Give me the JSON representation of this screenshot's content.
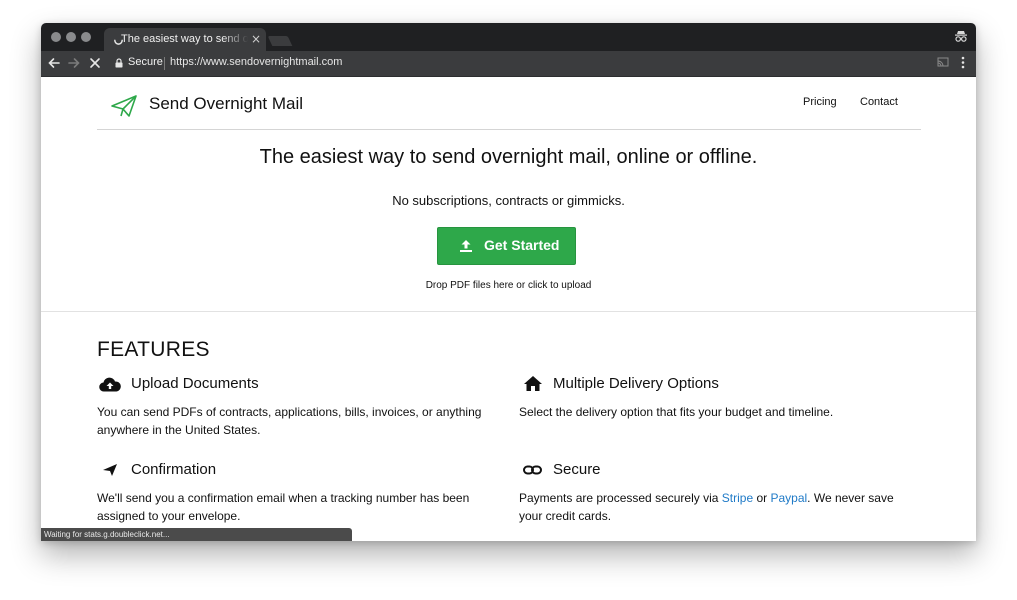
{
  "browser": {
    "tab_title": "The easiest way to send overnight mail",
    "tab_close": "×",
    "secure_label": "Secure",
    "url": "https://www.sendovernightmail.com",
    "status_text": "Waiting for stats.g.doubleclick.net..."
  },
  "site": {
    "brand": "Send Overnight Mail",
    "nav": {
      "pricing": "Pricing",
      "contact": "Contact"
    },
    "accent_color": "#2ea84a",
    "link_color": "#1f7ac7"
  },
  "hero": {
    "title": "The easiest way to send overnight mail, online or offline.",
    "subtitle": "No subscriptions, contracts or gimmicks.",
    "button_label": "Get Started",
    "drop_hint": "Drop PDF files here or click to upload"
  },
  "features": {
    "heading": "FEATURES",
    "upload": {
      "icon": "cloud-upload-icon",
      "title": "Upload Documents",
      "desc": "You can send PDFs of contracts, applications, bills, invoices, or anything anywhere in the United States."
    },
    "delivery": {
      "icon": "home-icon",
      "title": "Multiple Delivery Options",
      "desc": "Select the delivery option that fits your budget and timeline."
    },
    "confirmation": {
      "icon": "paper-plane-icon",
      "title": "Confirmation",
      "desc": "We'll send you a confirmation email when a tracking number has been assigned to your envelope."
    },
    "secure": {
      "icon": "link-icon",
      "title": "Secure",
      "desc_before": "Payments are processed securely via ",
      "link1": "Stripe",
      "desc_mid": " or ",
      "link2": "Paypal",
      "desc_after": ". We never save your credit cards."
    }
  }
}
